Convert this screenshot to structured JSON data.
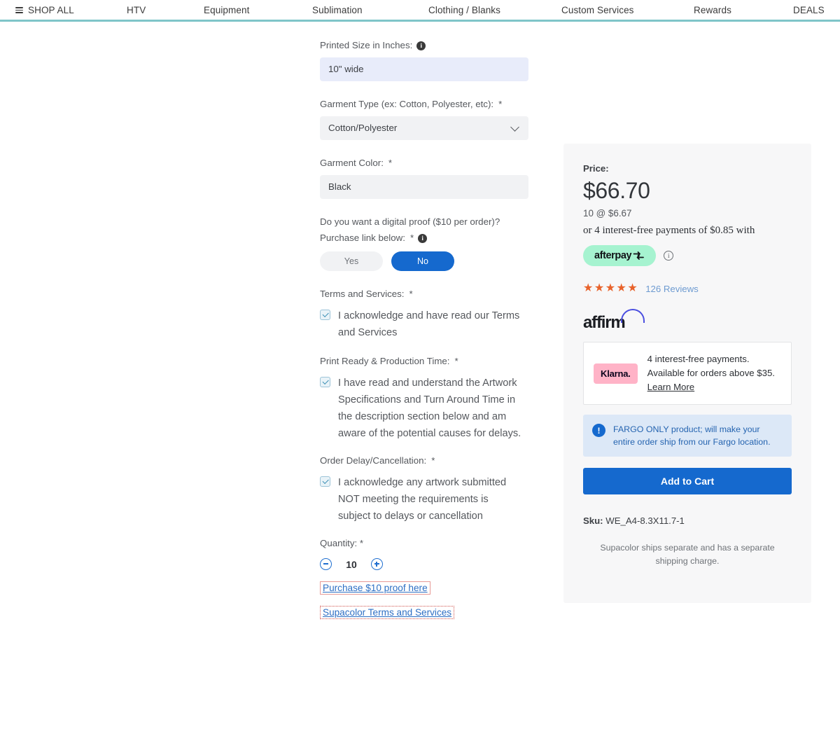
{
  "nav": {
    "items": [
      {
        "label": "SHOP ALL",
        "icon": "hamburger-icon"
      },
      {
        "label": "HTV"
      },
      {
        "label": "Equipment"
      },
      {
        "label": "Sublimation"
      },
      {
        "label": "Clothing / Blanks"
      },
      {
        "label": "Custom Services"
      },
      {
        "label": "Rewards"
      },
      {
        "label": "DEALS"
      }
    ],
    "accent_color": "#7fc5c9"
  },
  "form": {
    "printed_size": {
      "label": "Printed Size in Inches:",
      "value": "10\" wide",
      "has_info": true
    },
    "garment_type": {
      "label": "Garment Type (ex: Cotton, Polyester, etc):",
      "required": "*",
      "value": "Cotton/Polyester"
    },
    "garment_color": {
      "label": "Garment Color:",
      "required": "*",
      "value": "Black"
    },
    "digital_proof": {
      "label_line1": "Do you want a digital proof ($10 per order)?",
      "label_line2": "Purchase link below:",
      "required": "*",
      "has_info": true,
      "option_yes": "Yes",
      "option_no": "No",
      "selected": "No"
    },
    "terms": {
      "label": "Terms and Services:",
      "required": "*",
      "checkbox_text": "I acknowledge and have read our Terms and Services",
      "checked": true
    },
    "print_ready": {
      "label": "Print Ready & Production Time:",
      "required": "*",
      "checkbox_text": "I have read and understand the Artwork Specifications and Turn Around Time in the description section below and am aware of the potential causes for delays.",
      "checked": true
    },
    "order_delay": {
      "label": "Order Delay/Cancellation:",
      "required": "*",
      "checkbox_text": "I acknowledge any artwork submitted NOT meeting the requirements is subject to delays or cancellation",
      "checked": true
    },
    "quantity": {
      "label": "Quantity: *",
      "value": "10",
      "decrease_icon": "minus-circle-icon",
      "increase_icon": "plus-circle-icon"
    },
    "links": [
      {
        "label": "Purchase $10 proof here",
        "highlight": "solid-red-border"
      },
      {
        "label": "Supacolor Terms and Services",
        "highlight": "dotted-red-border"
      }
    ]
  },
  "price_panel": {
    "price_label": "Price:",
    "price_amount": "$66.70",
    "unit_price": "10 @ $6.67",
    "afterpay_line": "or 4 interest-free payments of $0.85 with",
    "afterpay_brand": "afterpay",
    "afterpay_badge_color": "#a6f3d0",
    "stars": "★★★★★",
    "star_color": "#e8622a",
    "reviews": "126 Reviews",
    "affirm_brand": "affirm",
    "klarna_brand": "Klarna.",
    "klarna_badge_color": "#ffb3c7",
    "klarna_text_1": "4 interest-free payments. Available for orders above $35. ",
    "klarna_link": "Learn More",
    "fargo_note": "FARGO ONLY product; will make your entire order ship from our Fargo location.",
    "add_to_cart": "Add to Cart",
    "sku_label": "Sku:",
    "sku_value": "WE_A4-8.3X11.7-1",
    "shipping_note": "Supacolor ships separate and has a separate shipping charge.",
    "accent_color": "#1569ce"
  }
}
